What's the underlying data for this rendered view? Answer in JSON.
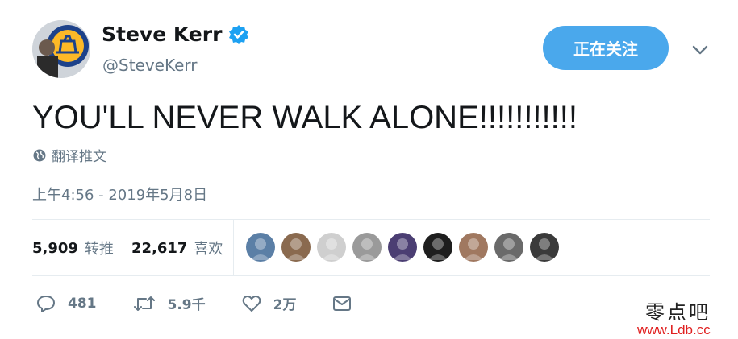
{
  "author": {
    "name": "Steve Kerr",
    "handle": "@SteveKerr",
    "verified": true
  },
  "follow_button": {
    "label": "正在关注"
  },
  "tweet": {
    "text": "YOU'LL NEVER WALK ALONE!!!!!!!!!!!",
    "translate_label": "翻译推文",
    "timestamp": "上午4:56 - 2019年5月8日"
  },
  "stats": {
    "retweets_count": "5,909",
    "retweets_label": "转推",
    "likes_count": "22,617",
    "likes_label": "喜欢"
  },
  "likers": [
    {
      "color": "#5b7fa6"
    },
    {
      "color": "#8a6a4f"
    },
    {
      "color": "#cfcfcf"
    },
    {
      "color": "#9a9a9a"
    },
    {
      "color": "#4b3e73"
    },
    {
      "color": "#1e1e1e"
    },
    {
      "color": "#a07860"
    },
    {
      "color": "#6a6a6a"
    },
    {
      "color": "#3a3a3a"
    }
  ],
  "actions": {
    "reply_count": "481",
    "retweet_count": "5.9千",
    "like_count": "2万"
  },
  "watermark": {
    "site_name": "零点吧",
    "url": "www.Ldb.cc"
  },
  "colors": {
    "accent": "#4aa8ec",
    "secondary_text": "#657786",
    "watermark_red": "#e02020"
  }
}
